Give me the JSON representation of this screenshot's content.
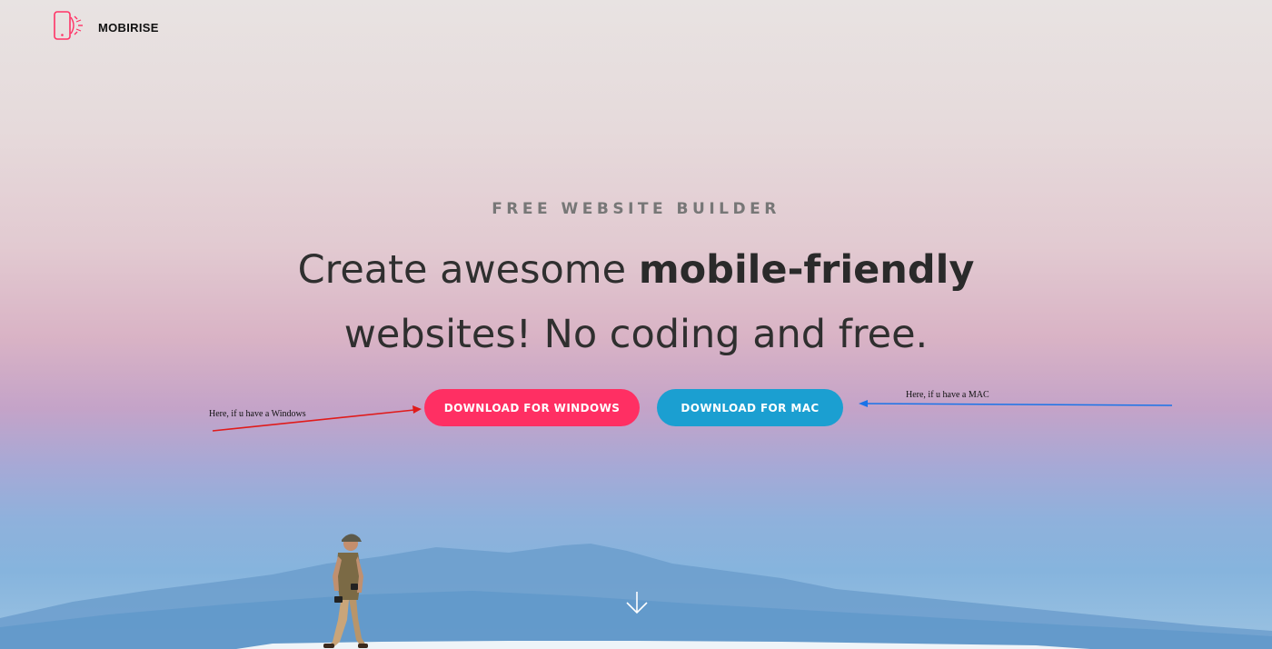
{
  "navbar": {
    "brand": "MOBIRISE",
    "logo_icon": "mobile-phone-icon"
  },
  "hero": {
    "eyebrow": "FREE WEBSITE BUILDER",
    "title_part1": "Create awesome ",
    "title_bold": "mobile-friendly",
    "title_line2": "websites! No coding and free.",
    "buttons": {
      "windows": "DOWNLOAD FOR WINDOWS",
      "mac": "DOWNLOAD FOR MAC"
    },
    "scroll_icon": "arrow-down-icon"
  },
  "annotations": {
    "windows_note": "Here, if u have a Windows",
    "mac_note": "Here, if u have a MAC"
  },
  "colors": {
    "accent_pink": "#ff2f63",
    "accent_blue": "#1b9fd1",
    "annotation_red": "#e01b1b",
    "annotation_blue": "#1a73e8"
  }
}
